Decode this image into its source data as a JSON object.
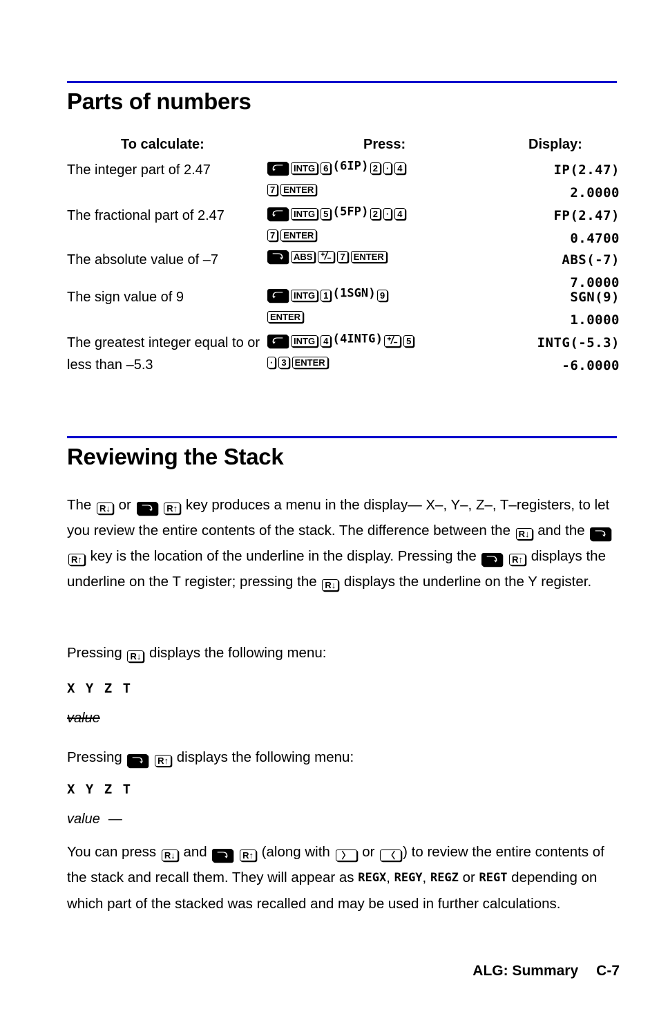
{
  "sections": {
    "parts": {
      "title": "Parts of numbers",
      "rule_color": "#0000cc",
      "headers": {
        "calculate": "To calculate:",
        "press": "Press:",
        "display": "Display:"
      },
      "rows": [
        {
          "desc": "The integer part of 2.47",
          "press_lines": [
            {
              "parts": [
                {
                  "t": "key",
                  "v": "shift-left",
                  "style": "dark"
                },
                {
                  "t": "key",
                  "v": "INTG"
                },
                {
                  "t": "key",
                  "v": "6"
                },
                {
                  "t": "paren",
                  "v": "("
                },
                {
                  "t": "lcd",
                  "v": "6IP"
                },
                {
                  "t": "paren",
                  "v": ")"
                },
                {
                  "t": "key",
                  "v": "2"
                },
                {
                  "t": "key",
                  "v": "·"
                },
                {
                  "t": "key",
                  "v": "4"
                }
              ]
            },
            {
              "parts": [
                {
                  "t": "key",
                  "v": "7"
                },
                {
                  "t": "key",
                  "v": "ENTER"
                }
              ]
            }
          ],
          "display_lines": [
            "IP(2.47)",
            "2.0000"
          ]
        },
        {
          "desc": "The fractional part of 2.47",
          "press_lines": [
            {
              "parts": [
                {
                  "t": "key",
                  "v": "shift-left",
                  "style": "dark"
                },
                {
                  "t": "key",
                  "v": "INTG"
                },
                {
                  "t": "key",
                  "v": "5"
                },
                {
                  "t": "paren",
                  "v": "("
                },
                {
                  "t": "lcd",
                  "v": "5FP"
                },
                {
                  "t": "paren",
                  "v": ")"
                },
                {
                  "t": "key",
                  "v": "2"
                },
                {
                  "t": "key",
                  "v": "·"
                },
                {
                  "t": "key",
                  "v": "4"
                }
              ]
            },
            {
              "parts": [
                {
                  "t": "key",
                  "v": "7"
                },
                {
                  "t": "key",
                  "v": "ENTER"
                }
              ]
            }
          ],
          "display_lines": [
            "FP(2.47)",
            "0.4700"
          ]
        },
        {
          "desc": "The absolute value of –7",
          "press_lines": [
            {
              "parts": [
                {
                  "t": "key",
                  "v": "shift-right",
                  "style": "dark"
                },
                {
                  "t": "key",
                  "v": "ABS"
                },
                {
                  "t": "key",
                  "v": "+/-"
                },
                {
                  "t": "key",
                  "v": "7"
                },
                {
                  "t": "key",
                  "v": "ENTER"
                }
              ]
            }
          ],
          "display_lines": [
            "ABS(-7)",
            "7.0000"
          ]
        },
        {
          "desc": "The sign value of 9",
          "press_lines": [
            {
              "parts": [
                {
                  "t": "key",
                  "v": "shift-left",
                  "style": "dark"
                },
                {
                  "t": "key",
                  "v": "INTG"
                },
                {
                  "t": "key",
                  "v": "1"
                },
                {
                  "t": "paren",
                  "v": "("
                },
                {
                  "t": "lcd",
                  "v": "1SGN"
                },
                {
                  "t": "paren",
                  "v": ")"
                },
                {
                  "t": "key",
                  "v": "9"
                }
              ]
            },
            {
              "parts": [
                {
                  "t": "key",
                  "v": "ENTER"
                }
              ]
            }
          ],
          "display_lines": [
            "SGN(9)",
            "1.0000"
          ]
        },
        {
          "desc": "The greatest integer equal  to or less than –5.3",
          "press_lines": [
            {
              "parts": [
                {
                  "t": "key",
                  "v": "shift-left",
                  "style": "dark"
                },
                {
                  "t": "key",
                  "v": "INTG"
                },
                {
                  "t": "key",
                  "v": "4"
                },
                {
                  "t": "paren",
                  "v": "("
                },
                {
                  "t": "lcd",
                  "v": "4INTG"
                },
                {
                  "t": "paren",
                  "v": ")"
                },
                {
                  "t": "key",
                  "v": "+/-"
                },
                {
                  "t": "key",
                  "v": "5"
                }
              ]
            },
            {
              "parts": [
                {
                  "t": "key",
                  "v": "·"
                },
                {
                  "t": "key",
                  "v": "3"
                },
                {
                  "t": "key",
                  "v": "ENTER"
                }
              ]
            }
          ],
          "display_lines": [
            "INTG(-5.3)",
            "-6.0000"
          ]
        }
      ]
    },
    "stack": {
      "title": "Reviewing the Stack",
      "rule_color": "#0000cc",
      "intro_parts": [
        {
          "t": "text",
          "v": "The "
        },
        {
          "t": "key",
          "v": "R-down"
        },
        {
          "t": "text",
          "v": " or "
        },
        {
          "t": "key",
          "v": "shift-right",
          "style": "dark"
        },
        {
          "t": "text",
          "v": " "
        },
        {
          "t": "key",
          "v": "R-up"
        },
        {
          "t": "text",
          "v": " key produces a menu in the display— X–, Y–, Z–, T–registers, to let you review the entire contents of the stack. The difference between the "
        },
        {
          "t": "key",
          "v": "R-down"
        },
        {
          "t": "text",
          "v": " and the "
        },
        {
          "t": "key",
          "v": "shift-right",
          "style": "dark"
        },
        {
          "t": "text",
          "v": " "
        },
        {
          "t": "key",
          "v": "R-up"
        },
        {
          "t": "text",
          "v": " key is the location of the underline in the display. Pressing the "
        },
        {
          "t": "key",
          "v": "shift-right",
          "style": "dark"
        },
        {
          "t": "text",
          "v": " "
        },
        {
          "t": "key",
          "v": "R-up"
        },
        {
          "t": "text",
          "v": " displays the underline on the T register; pressing the "
        },
        {
          "t": "key",
          "v": "R-down"
        },
        {
          "t": "text",
          "v": " displays the underline on the Y register."
        }
      ],
      "block1": {
        "lead_parts": [
          {
            "t": "text",
            "v": "Pressing "
          },
          {
            "t": "key",
            "v": "R-down"
          },
          {
            "t": "text",
            "v": " displays the following menu:"
          }
        ],
        "menu_line": "X Y Z T",
        "value_label": "value",
        "value_struck": true,
        "value_dash": ""
      },
      "block2": {
        "lead_parts": [
          {
            "t": "text",
            "v": "Pressing "
          },
          {
            "t": "key",
            "v": "shift-right",
            "style": "dark"
          },
          {
            "t": "text",
            "v": " "
          },
          {
            "t": "key",
            "v": "R-up"
          },
          {
            "t": "text",
            "v": " displays the following menu:"
          }
        ],
        "menu_line": "X Y Z T",
        "value_label": "value",
        "value_struck": false,
        "value_dash": "—"
      },
      "outro_parts": [
        {
          "t": "text",
          "v": "You can press "
        },
        {
          "t": "key",
          "v": "R-down"
        },
        {
          "t": "text",
          "v": " and "
        },
        {
          "t": "key",
          "v": "shift-right",
          "style": "dark"
        },
        {
          "t": "text",
          "v": " "
        },
        {
          "t": "key",
          "v": "R-up"
        },
        {
          "t": "text",
          "v": " (along with "
        },
        {
          "t": "key",
          "v": "〉",
          "style": "wide"
        },
        {
          "t": "text",
          "v": " or "
        },
        {
          "t": "key",
          "v": "〈",
          "style": "wide"
        },
        {
          "t": "text",
          "v": ") to review the entire contents of the stack and recall them. They will appear as "
        },
        {
          "t": "lcd",
          "v": "REGX"
        },
        {
          "t": "text",
          "v": ", "
        },
        {
          "t": "lcd",
          "v": "REGY"
        },
        {
          "t": "text",
          "v": ", "
        },
        {
          "t": "lcd",
          "v": "REGZ"
        },
        {
          "t": "text",
          "v": " or "
        },
        {
          "t": "lcd",
          "v": "REGT"
        },
        {
          "t": "text",
          "v": " depending on which part of the stacked was recalled and may be used in further calculations."
        }
      ]
    }
  },
  "footer": {
    "section": "ALG: Summary",
    "page": "C-7"
  }
}
